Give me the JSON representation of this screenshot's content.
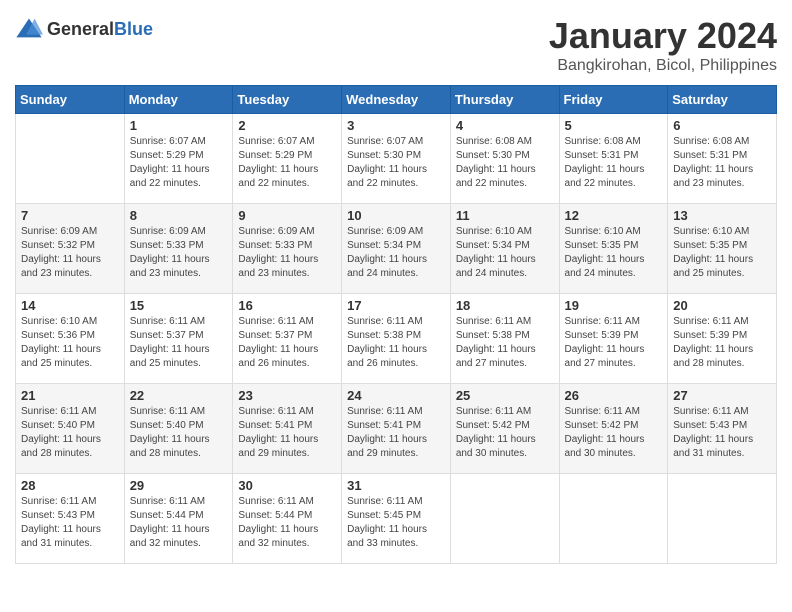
{
  "logo": {
    "text_general": "General",
    "text_blue": "Blue"
  },
  "header": {
    "title": "January 2024",
    "subtitle": "Bangkirohan, Bicol, Philippines"
  },
  "weekdays": [
    "Sunday",
    "Monday",
    "Tuesday",
    "Wednesday",
    "Thursday",
    "Friday",
    "Saturday"
  ],
  "weeks": [
    [
      {
        "day": "",
        "sunrise": "",
        "sunset": "",
        "daylight": ""
      },
      {
        "day": "1",
        "sunrise": "Sunrise: 6:07 AM",
        "sunset": "Sunset: 5:29 PM",
        "daylight": "Daylight: 11 hours and 22 minutes."
      },
      {
        "day": "2",
        "sunrise": "Sunrise: 6:07 AM",
        "sunset": "Sunset: 5:29 PM",
        "daylight": "Daylight: 11 hours and 22 minutes."
      },
      {
        "day": "3",
        "sunrise": "Sunrise: 6:07 AM",
        "sunset": "Sunset: 5:30 PM",
        "daylight": "Daylight: 11 hours and 22 minutes."
      },
      {
        "day": "4",
        "sunrise": "Sunrise: 6:08 AM",
        "sunset": "Sunset: 5:30 PM",
        "daylight": "Daylight: 11 hours and 22 minutes."
      },
      {
        "day": "5",
        "sunrise": "Sunrise: 6:08 AM",
        "sunset": "Sunset: 5:31 PM",
        "daylight": "Daylight: 11 hours and 22 minutes."
      },
      {
        "day": "6",
        "sunrise": "Sunrise: 6:08 AM",
        "sunset": "Sunset: 5:31 PM",
        "daylight": "Daylight: 11 hours and 23 minutes."
      }
    ],
    [
      {
        "day": "7",
        "sunrise": "Sunrise: 6:09 AM",
        "sunset": "Sunset: 5:32 PM",
        "daylight": "Daylight: 11 hours and 23 minutes."
      },
      {
        "day": "8",
        "sunrise": "Sunrise: 6:09 AM",
        "sunset": "Sunset: 5:33 PM",
        "daylight": "Daylight: 11 hours and 23 minutes."
      },
      {
        "day": "9",
        "sunrise": "Sunrise: 6:09 AM",
        "sunset": "Sunset: 5:33 PM",
        "daylight": "Daylight: 11 hours and 23 minutes."
      },
      {
        "day": "10",
        "sunrise": "Sunrise: 6:09 AM",
        "sunset": "Sunset: 5:34 PM",
        "daylight": "Daylight: 11 hours and 24 minutes."
      },
      {
        "day": "11",
        "sunrise": "Sunrise: 6:10 AM",
        "sunset": "Sunset: 5:34 PM",
        "daylight": "Daylight: 11 hours and 24 minutes."
      },
      {
        "day": "12",
        "sunrise": "Sunrise: 6:10 AM",
        "sunset": "Sunset: 5:35 PM",
        "daylight": "Daylight: 11 hours and 24 minutes."
      },
      {
        "day": "13",
        "sunrise": "Sunrise: 6:10 AM",
        "sunset": "Sunset: 5:35 PM",
        "daylight": "Daylight: 11 hours and 25 minutes."
      }
    ],
    [
      {
        "day": "14",
        "sunrise": "Sunrise: 6:10 AM",
        "sunset": "Sunset: 5:36 PM",
        "daylight": "Daylight: 11 hours and 25 minutes."
      },
      {
        "day": "15",
        "sunrise": "Sunrise: 6:11 AM",
        "sunset": "Sunset: 5:37 PM",
        "daylight": "Daylight: 11 hours and 25 minutes."
      },
      {
        "day": "16",
        "sunrise": "Sunrise: 6:11 AM",
        "sunset": "Sunset: 5:37 PM",
        "daylight": "Daylight: 11 hours and 26 minutes."
      },
      {
        "day": "17",
        "sunrise": "Sunrise: 6:11 AM",
        "sunset": "Sunset: 5:38 PM",
        "daylight": "Daylight: 11 hours and 26 minutes."
      },
      {
        "day": "18",
        "sunrise": "Sunrise: 6:11 AM",
        "sunset": "Sunset: 5:38 PM",
        "daylight": "Daylight: 11 hours and 27 minutes."
      },
      {
        "day": "19",
        "sunrise": "Sunrise: 6:11 AM",
        "sunset": "Sunset: 5:39 PM",
        "daylight": "Daylight: 11 hours and 27 minutes."
      },
      {
        "day": "20",
        "sunrise": "Sunrise: 6:11 AM",
        "sunset": "Sunset: 5:39 PM",
        "daylight": "Daylight: 11 hours and 28 minutes."
      }
    ],
    [
      {
        "day": "21",
        "sunrise": "Sunrise: 6:11 AM",
        "sunset": "Sunset: 5:40 PM",
        "daylight": "Daylight: 11 hours and 28 minutes."
      },
      {
        "day": "22",
        "sunrise": "Sunrise: 6:11 AM",
        "sunset": "Sunset: 5:40 PM",
        "daylight": "Daylight: 11 hours and 28 minutes."
      },
      {
        "day": "23",
        "sunrise": "Sunrise: 6:11 AM",
        "sunset": "Sunset: 5:41 PM",
        "daylight": "Daylight: 11 hours and 29 minutes."
      },
      {
        "day": "24",
        "sunrise": "Sunrise: 6:11 AM",
        "sunset": "Sunset: 5:41 PM",
        "daylight": "Daylight: 11 hours and 29 minutes."
      },
      {
        "day": "25",
        "sunrise": "Sunrise: 6:11 AM",
        "sunset": "Sunset: 5:42 PM",
        "daylight": "Daylight: 11 hours and 30 minutes."
      },
      {
        "day": "26",
        "sunrise": "Sunrise: 6:11 AM",
        "sunset": "Sunset: 5:42 PM",
        "daylight": "Daylight: 11 hours and 30 minutes."
      },
      {
        "day": "27",
        "sunrise": "Sunrise: 6:11 AM",
        "sunset": "Sunset: 5:43 PM",
        "daylight": "Daylight: 11 hours and 31 minutes."
      }
    ],
    [
      {
        "day": "28",
        "sunrise": "Sunrise: 6:11 AM",
        "sunset": "Sunset: 5:43 PM",
        "daylight": "Daylight: 11 hours and 31 minutes."
      },
      {
        "day": "29",
        "sunrise": "Sunrise: 6:11 AM",
        "sunset": "Sunset: 5:44 PM",
        "daylight": "Daylight: 11 hours and 32 minutes."
      },
      {
        "day": "30",
        "sunrise": "Sunrise: 6:11 AM",
        "sunset": "Sunset: 5:44 PM",
        "daylight": "Daylight: 11 hours and 32 minutes."
      },
      {
        "day": "31",
        "sunrise": "Sunrise: 6:11 AM",
        "sunset": "Sunset: 5:45 PM",
        "daylight": "Daylight: 11 hours and 33 minutes."
      },
      {
        "day": "",
        "sunrise": "",
        "sunset": "",
        "daylight": ""
      },
      {
        "day": "",
        "sunrise": "",
        "sunset": "",
        "daylight": ""
      },
      {
        "day": "",
        "sunrise": "",
        "sunset": "",
        "daylight": ""
      }
    ]
  ]
}
